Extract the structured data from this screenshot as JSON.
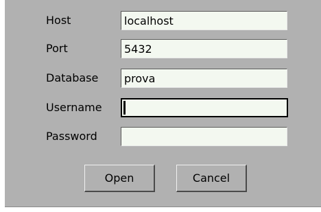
{
  "form": {
    "host": {
      "label": "Host",
      "value": "localhost"
    },
    "port": {
      "label": "Port",
      "value": "5432"
    },
    "database": {
      "label": "Database",
      "value": "prova"
    },
    "username": {
      "label": "Username",
      "value": ""
    },
    "password": {
      "label": "Password",
      "value": ""
    }
  },
  "buttons": {
    "open_label": "Open",
    "cancel_label": "Cancel"
  },
  "colors": {
    "dialog_background": "#b1b1b1",
    "field_background": "#f3f8f0"
  }
}
